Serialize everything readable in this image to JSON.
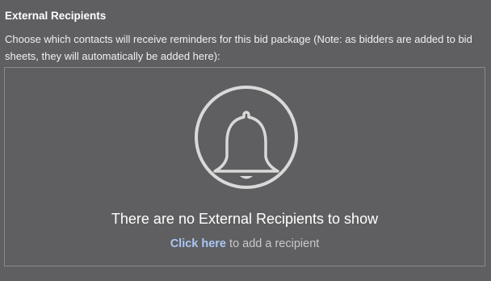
{
  "section": {
    "title": "External Recipients",
    "description": "Choose which contacts will receive reminders for this bid package (Note: as bidders are added to bid sheets, they will automatically be added here):"
  },
  "empty_state": {
    "icon": "bell-icon",
    "message": "There are no External Recipients to show",
    "link_label": "Click here",
    "hint_suffix": " to add a recipient"
  },
  "colors": {
    "background": "#5f5f61",
    "link": "#a9c7f5",
    "icon": "#d9d9d9"
  }
}
